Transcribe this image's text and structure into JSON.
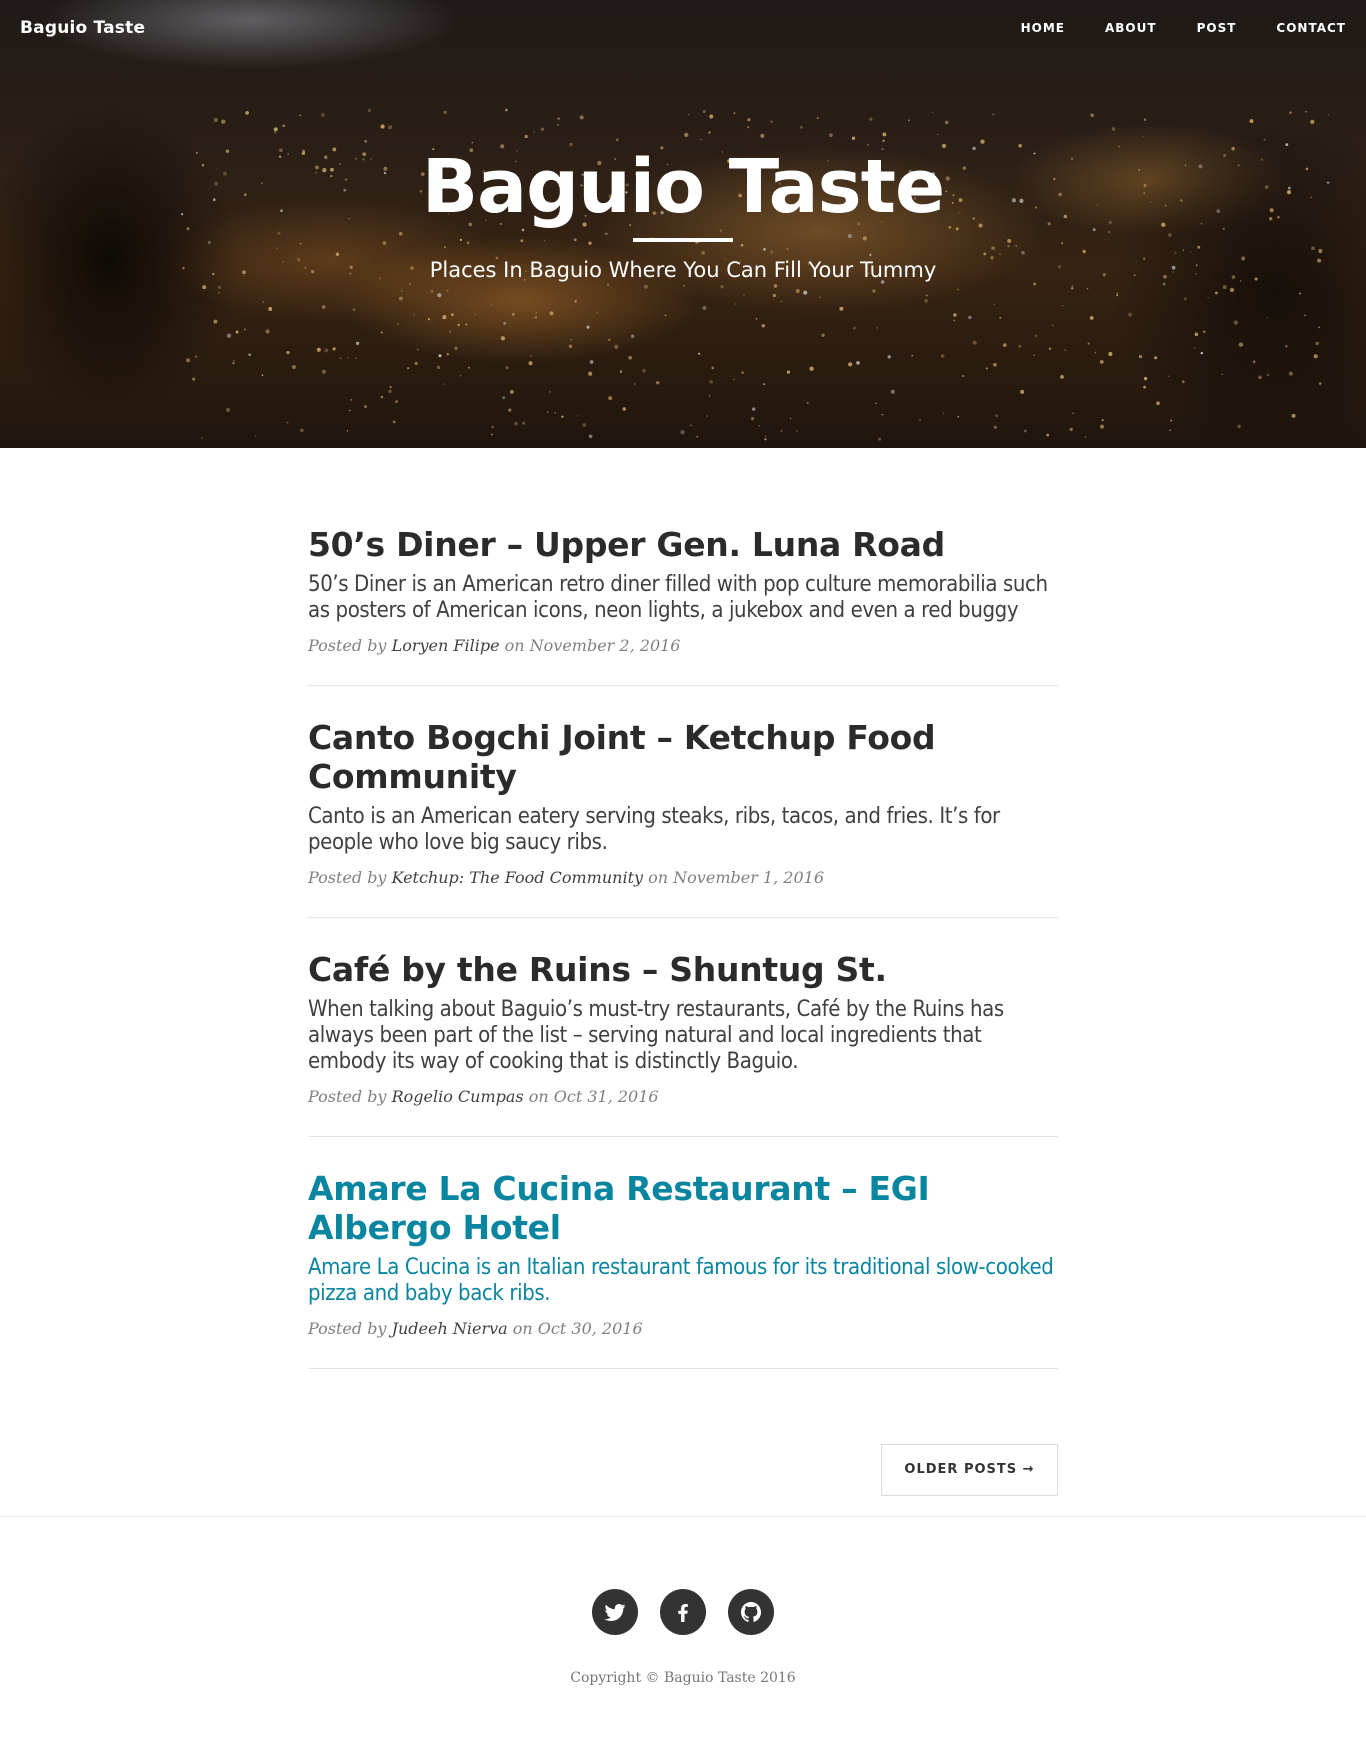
{
  "navbar": {
    "brand": "Baguio Taste",
    "links": [
      "HOME",
      "ABOUT",
      "POST",
      "CONTACT"
    ]
  },
  "hero": {
    "title": "Baguio Taste",
    "subtitle": "Places In Baguio Where You Can Fill Your Tummy"
  },
  "posts": [
    {
      "title": "50’s Diner – Upper Gen. Luna Road",
      "excerpt": "50’s Diner is an American retro diner filled with pop culture memorabilia such as posters of American icons, neon lights, a jukebox and even a red buggy",
      "posted_by": "Posted by",
      "author": "Loryen Filipe",
      "on": "on",
      "date": "November 2, 2016"
    },
    {
      "title": "Canto Bogchi Joint – Ketchup Food Community",
      "excerpt": "Canto is an American eatery serving steaks, ribs, tacos, and fries. It’s for people who love big saucy ribs.",
      "posted_by": "Posted by",
      "author": "Ketchup: The Food Community",
      "on": "on",
      "date": "November 1, 2016"
    },
    {
      "title": "Café by the Ruins – Shuntug St.",
      "excerpt": "When talking about Baguio’s must-try restaurants, Café by the Ruins has always been part of the list – serving natural and local ingredients that embody its way of cooking that is distinctly Baguio.",
      "posted_by": "Posted by",
      "author": "Rogelio Cumpas",
      "on": "on",
      "date": "Oct 31, 2016"
    },
    {
      "title": "Amare La Cucina Restaurant – EGI Albergo Hotel",
      "excerpt": "Amare La Cucina is an Italian restaurant famous for its traditional slow-cooked pizza and baby back ribs.",
      "posted_by": "Posted by",
      "author": "Judeeh Nierva",
      "on": "on",
      "date": "Oct 30, 2016"
    }
  ],
  "pager": {
    "older": "OLDER POSTS →"
  },
  "footer": {
    "social_icons": [
      "twitter-icon",
      "facebook-icon",
      "github-icon"
    ],
    "copyright": "Copyright © Baguio Taste 2016"
  },
  "colors": {
    "link_hover": "#0a85a0",
    "title_text": "#2b2b2b",
    "meta_text": "#808080",
    "social_bg": "#333333"
  }
}
